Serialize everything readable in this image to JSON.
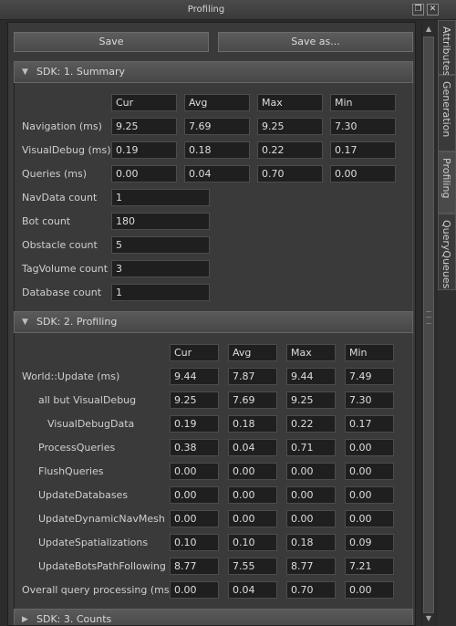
{
  "window": {
    "title": "Profiling"
  },
  "toolbar": {
    "save": "Save",
    "save_as": "Save as..."
  },
  "side_tabs": [
    "Attributes",
    "Generation",
    "Profiling",
    "QueryQueues"
  ],
  "sections": [
    {
      "title": "SDK: 1. Summary",
      "expanded": true
    },
    {
      "title": "SDK: 2. Profiling",
      "expanded": true
    },
    {
      "title": "SDK: 3. Counts",
      "expanded": false
    }
  ],
  "summary": {
    "columns": [
      "Cur",
      "Avg",
      "Max",
      "Min"
    ],
    "rows": [
      {
        "label": "Navigation (ms)",
        "values": [
          "9.25",
          "7.69",
          "9.25",
          "7.30"
        ]
      },
      {
        "label": "VisualDebug (ms)",
        "values": [
          "0.19",
          "0.18",
          "0.22",
          "0.17"
        ]
      },
      {
        "label": "Queries (ms)",
        "values": [
          "0.00",
          "0.04",
          "0.70",
          "0.00"
        ]
      }
    ],
    "counts": [
      {
        "label": "NavData count",
        "value": "1"
      },
      {
        "label": "Bot count",
        "value": "180"
      },
      {
        "label": "Obstacle count",
        "value": "5"
      },
      {
        "label": "TagVolume count",
        "value": "3"
      },
      {
        "label": "Database count",
        "value": "1"
      }
    ]
  },
  "profiling": {
    "columns": [
      "Cur",
      "Avg",
      "Max",
      "Min"
    ],
    "rows": [
      {
        "label": "World::Update (ms)",
        "values": [
          "9.44",
          "7.87",
          "9.44",
          "7.49"
        ]
      },
      {
        "label": "all but VisualDebug",
        "values": [
          "9.25",
          "7.69",
          "9.25",
          "7.30"
        ]
      },
      {
        "label": "VisualDebugData",
        "values": [
          "0.19",
          "0.18",
          "0.22",
          "0.17"
        ]
      },
      {
        "label": "ProcessQueries",
        "values": [
          "0.38",
          "0.04",
          "0.71",
          "0.00"
        ]
      },
      {
        "label": "FlushQueries",
        "values": [
          "0.00",
          "0.00",
          "0.00",
          "0.00"
        ]
      },
      {
        "label": "UpdateDatabases",
        "values": [
          "0.00",
          "0.00",
          "0.00",
          "0.00"
        ]
      },
      {
        "label": "UpdateDynamicNavMesh",
        "values": [
          "0.00",
          "0.00",
          "0.00",
          "0.00"
        ]
      },
      {
        "label": "UpdateSpatializations",
        "values": [
          "0.10",
          "0.10",
          "0.18",
          "0.09"
        ]
      },
      {
        "label": "UpdateBotsPathFollowing",
        "values": [
          "8.77",
          "7.55",
          "8.77",
          "7.21"
        ]
      },
      {
        "label": "Overall query processing (ms)",
        "values": [
          "0.00",
          "0.04",
          "0.70",
          "0.00"
        ]
      }
    ]
  }
}
